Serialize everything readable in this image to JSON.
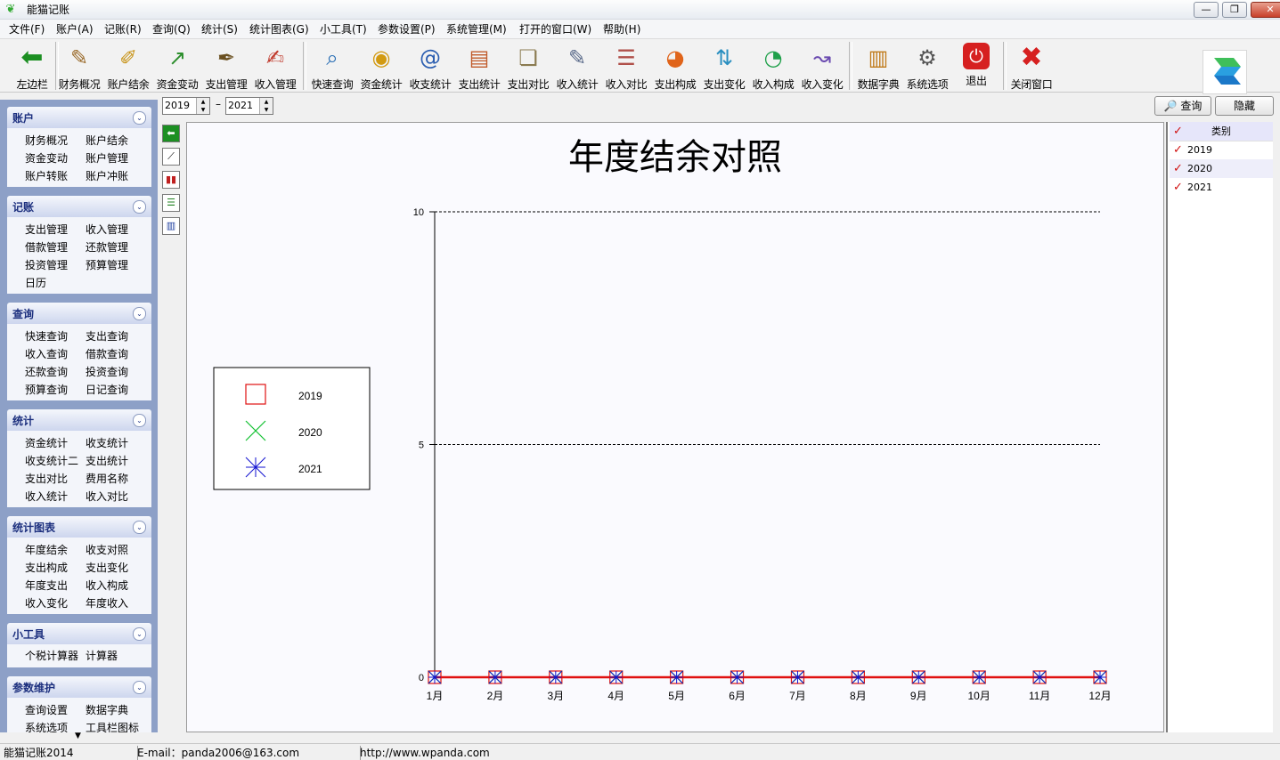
{
  "window": {
    "title": "能猫记账",
    "minimize": "—",
    "restore": "❐",
    "close": "✕"
  },
  "menu": [
    "文件(F)",
    "账户(A)",
    "记账(R)",
    "查询(Q)",
    "统计(S)",
    "统计图表(G)",
    "小工具(T)",
    "参数设置(P)",
    "系统管理(M)",
    "打开的窗口(W)",
    "帮助(H)"
  ],
  "toolbar": [
    {
      "label": "左边栏",
      "icon": "green-left-arrow-icon",
      "color": "#1c8f22"
    },
    {
      "label": "财务概况",
      "icon": "finance-overview-icon",
      "color": "#9a6a2a"
    },
    {
      "label": "账户结余",
      "icon": "account-balance-icon",
      "color": "#c79214"
    },
    {
      "label": "资金变动",
      "icon": "fund-change-chart-icon",
      "color": "#2d8f2d"
    },
    {
      "label": "支出管理",
      "icon": "expense-pen-icon",
      "color": "#6a5020"
    },
    {
      "label": "收入管理",
      "icon": "income-pen-icon",
      "color": "#c0392b"
    },
    {
      "label": "快速查询",
      "icon": "magnifier-icon",
      "color": "#2b6fb5"
    },
    {
      "label": "资金统计",
      "icon": "coins-icon",
      "color": "#d29a12"
    },
    {
      "label": "收支统计",
      "icon": "at-sign-book-icon",
      "color": "#2a5db0"
    },
    {
      "label": "支出统计",
      "icon": "notepad-icon",
      "color": "#c05a2a"
    },
    {
      "label": "支出对比",
      "icon": "document-compare-icon",
      "color": "#8a7a50"
    },
    {
      "label": "收入统计",
      "icon": "document-pen-icon",
      "color": "#5a6a8a"
    },
    {
      "label": "收入对比",
      "icon": "document-list-icon",
      "color": "#b0504a"
    },
    {
      "label": "支出构成",
      "icon": "pie-chart-icon",
      "color": "#e0641a"
    },
    {
      "label": "支出变化",
      "icon": "arrows-up-icon",
      "color": "#2a8fc0"
    },
    {
      "label": "收入构成",
      "icon": "pie-3d-icon",
      "color": "#1fa04a"
    },
    {
      "label": "收入变化",
      "icon": "line-chart-up-icon",
      "color": "#6a4ab0"
    },
    {
      "label": "数据字典",
      "icon": "books-icon",
      "color": "#c07a1a"
    },
    {
      "label": "系统选项",
      "icon": "gear-icon",
      "color": "#555555"
    },
    {
      "label": "退出",
      "icon": "power-icon",
      "color": "#d62020"
    },
    {
      "label": "关闭窗口",
      "icon": "red-x-icon",
      "color": "#d62020"
    }
  ],
  "date_range": {
    "from": "2019",
    "to": "2021",
    "separator": "–"
  },
  "buttons": {
    "query": "查询",
    "query_icon": "🔎",
    "hide": "隐藏"
  },
  "sidebar": [
    {
      "title": "账户",
      "items": [
        "财务概况",
        "账户结余",
        "资金变动",
        "账户管理",
        "账户转账",
        "账户冲账"
      ]
    },
    {
      "title": "记账",
      "items": [
        "支出管理",
        "收入管理",
        "借款管理",
        "还款管理",
        "投资管理",
        "预算管理",
        "日历"
      ]
    },
    {
      "title": "查询",
      "items": [
        "快速查询",
        "支出查询",
        "收入查询",
        "借款查询",
        "还款查询",
        "投资查询",
        "预算查询",
        "日记查询"
      ]
    },
    {
      "title": "统计",
      "items": [
        "资金统计",
        "收支统计",
        "收支统计二",
        "支出统计",
        "支出对比",
        "费用名称",
        "收入统计",
        "收入对比"
      ]
    },
    {
      "title": "统计图表",
      "items": [
        "年度结余",
        "收支对照",
        "支出构成",
        "支出变化",
        "年度支出",
        "收入构成",
        "收入变化",
        "年度收入"
      ]
    },
    {
      "title": "小工具",
      "items": [
        "个税计算器",
        "计算器"
      ]
    },
    {
      "title": "参数维护",
      "items": [
        "查询设置",
        "数据字典",
        "系统选项",
        "工具栏图标"
      ]
    }
  ],
  "side_tools": [
    "back-icon",
    "line-chart-icon",
    "bar-chart-icon",
    "horizontal-bar-icon",
    "stacked-bar-icon"
  ],
  "category_panel": {
    "header": "类别",
    "items": [
      "2019",
      "2020",
      "2021"
    ]
  },
  "chart_data": {
    "type": "line",
    "title": "年度结余对照",
    "categories": [
      "1月",
      "2月",
      "3月",
      "4月",
      "5月",
      "6月",
      "7月",
      "8月",
      "9月",
      "10月",
      "11月",
      "12月"
    ],
    "ylim": [
      0,
      10
    ],
    "yticks": [
      0,
      5,
      10
    ],
    "grid": "dashed-horizontal",
    "legend": "left",
    "series": [
      {
        "name": "2019",
        "values": [
          0,
          0,
          0,
          0,
          0,
          0,
          0,
          0,
          0,
          0,
          0,
          0
        ],
        "color": "#e01010",
        "marker": "square"
      },
      {
        "name": "2020",
        "values": [
          0,
          0,
          0,
          0,
          0,
          0,
          0,
          0,
          0,
          0,
          0,
          0
        ],
        "color": "#10c030",
        "marker": "x"
      },
      {
        "name": "2021",
        "values": [
          0,
          0,
          0,
          0,
          0,
          0,
          0,
          0,
          0,
          0,
          0,
          0
        ],
        "color": "#1010d0",
        "marker": "star"
      }
    ]
  },
  "statusbar": [
    "能猫记账2014",
    "E-mail：panda2006@163.com",
    "http://www.wpanda.com"
  ]
}
